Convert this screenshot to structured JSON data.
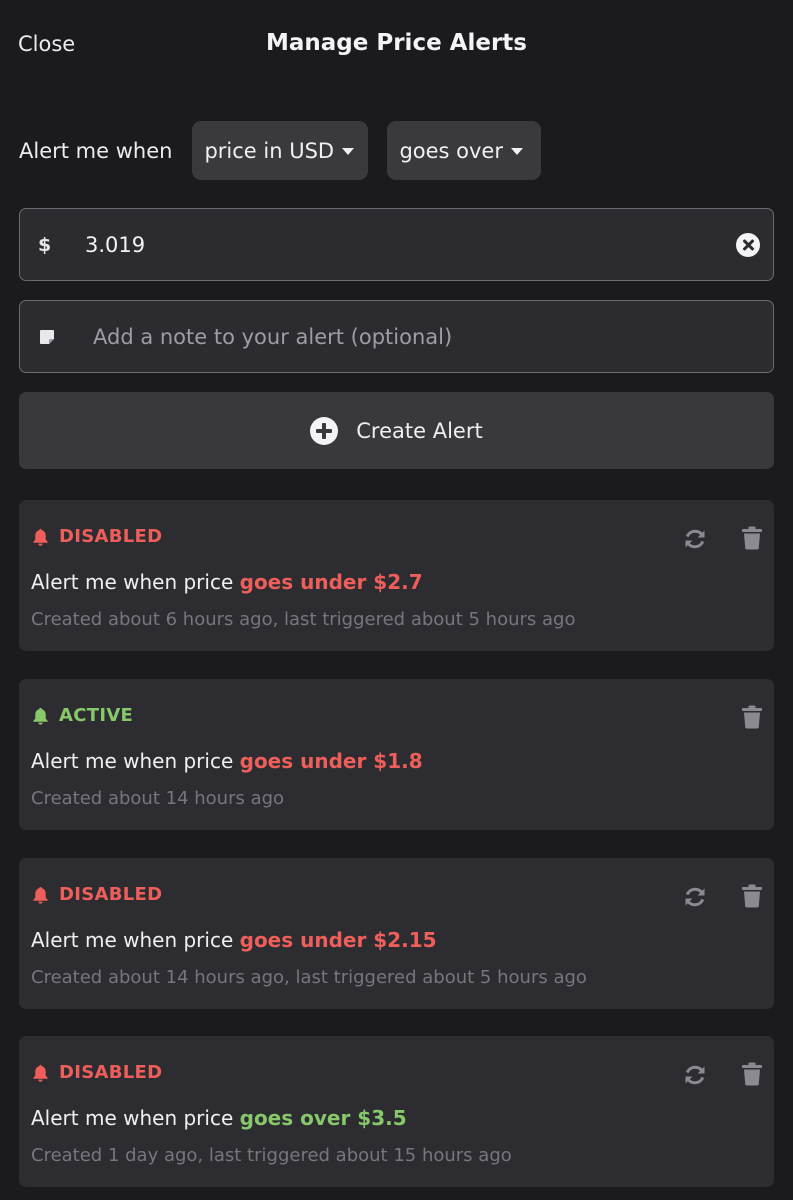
{
  "header": {
    "close_label": "Close",
    "title": "Manage Price Alerts"
  },
  "form": {
    "condition_label": "Alert me when",
    "metric_select": "price in USD",
    "direction_select": "goes over",
    "currency_symbol": "$",
    "price_value": "3.019",
    "note_placeholder": "Add a note to your alert (optional)",
    "create_label": "Create Alert"
  },
  "colors": {
    "background": "#1b1b1d",
    "card": "#2d2d31",
    "disabled_red": "#ee5e5a",
    "active_green": "#86c86a",
    "muted_text": "#76767c"
  },
  "alerts": [
    {
      "status": "DISABLED",
      "prefix": "Alert me when price",
      "condition": "goes under $2.7",
      "meta": "Created about 6 hours ago, last triggered about 5 hours ago",
      "icons": [
        "bell-icon",
        "refresh-icon",
        "trash-icon"
      ]
    },
    {
      "status": "ACTIVE",
      "prefix": "Alert me when price",
      "condition": "goes under $1.8",
      "meta": "Created about 14 hours ago",
      "icons": [
        "bell-icon",
        "trash-icon"
      ]
    },
    {
      "status": "DISABLED",
      "prefix": "Alert me when price",
      "condition": "goes under $2.15",
      "meta": "Created about 14 hours ago, last triggered about 5 hours ago",
      "icons": [
        "bell-icon",
        "refresh-icon",
        "trash-icon"
      ]
    },
    {
      "status": "DISABLED",
      "prefix": "Alert me when price",
      "condition": "goes over $3.5",
      "meta": "Created 1 day ago, last triggered about 15 hours ago",
      "icons": [
        "bell-icon",
        "refresh-icon",
        "trash-icon"
      ]
    }
  ]
}
